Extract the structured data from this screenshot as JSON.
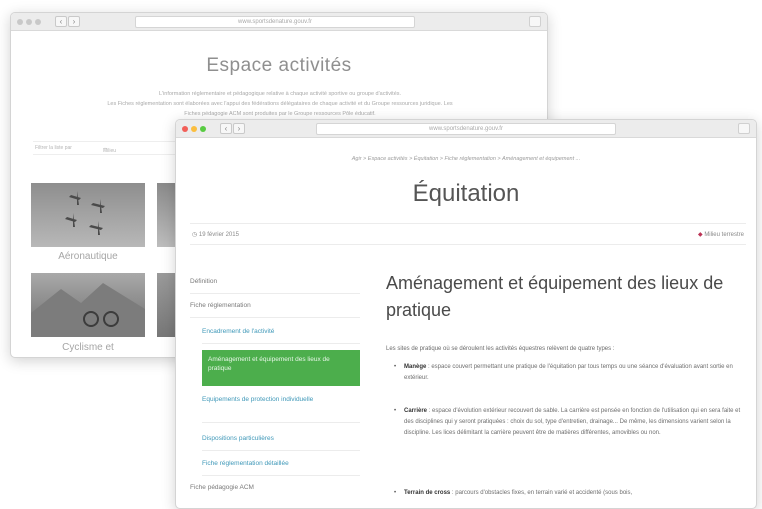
{
  "back_window": {
    "url": "www.sportsdenature.gouv.fr",
    "title": "Espace activités",
    "intro": [
      "L'information réglementaire et pédagogique relative à chaque activité sportive ou groupe d'activités.",
      "Les Fiches réglementation sont élaborées avec l'appui des fédérations délégataires de chaque activité et du Groupe ressources juridique. Les",
      "Fiches pédagogie ACM sont produites par le Groupe ressources Pôle éducatif."
    ],
    "filter_label": "Filtrer la liste par",
    "filter_select": "Milieu",
    "cards": [
      "Aéronautique",
      "Cyclisme et"
    ]
  },
  "front_window": {
    "url": "www.sportsdenature.gouv.fr",
    "breadcrumb": "Agir > Espace activités > Équitation > Fiche réglementation > Aménagement et équipement ...",
    "page_title": "Équitation",
    "date": "19 février 2015",
    "category_tag": "Milieu terrestre",
    "sidebar": [
      {
        "label": "Définition",
        "level": 0,
        "active": false
      },
      {
        "label": "Fiche réglementation",
        "level": 0,
        "active": false
      },
      {
        "label": "Encadrement de l'activité",
        "level": 1,
        "active": false
      },
      {
        "label": "Aménagement et équipement des lieux de pratique",
        "level": 1,
        "active": true
      },
      {
        "label": "Equipements de protection individuelle",
        "level": 1,
        "active": false
      },
      {
        "label": "Dispositions particulières",
        "level": 1,
        "active": false
      },
      {
        "label": "Fiche réglementation détaillée",
        "level": 1,
        "active": false
      },
      {
        "label": "Fiche pédagogie ACM",
        "level": 0,
        "active": false
      }
    ],
    "article": {
      "heading": "Aménagement et équipement des lieux de pratique",
      "lead": "Les sites de pratique où se déroulent les activités équestres relèvent de quatre types :",
      "items": [
        {
          "term": "Manège",
          "text": " : espace couvert permettant une pratique de l'équitation par tous temps ou une séance d'évaluation avant sortie en extérieur."
        },
        {
          "term": "Carrière",
          "text": " : espace d'évolution extérieur recouvert de sable. La carrière est pensée en fonction de l'utilisation qui en sera faite et des disciplines qui y seront pratiquées : choix du sol, type d'entretien, drainage... De même, les dimensions varient selon la discipline. Les lices délimitant la carrière peuvent être de matières différentes, amovibles ou non."
        },
        {
          "term": "Terrain de cross",
          "text": " : parcours d'obstacles fixes, en terrain varié et accidenté (sous bois,"
        }
      ]
    }
  },
  "colors": {
    "accent_green": "#4cae4c",
    "link_blue": "#3f98b8"
  }
}
